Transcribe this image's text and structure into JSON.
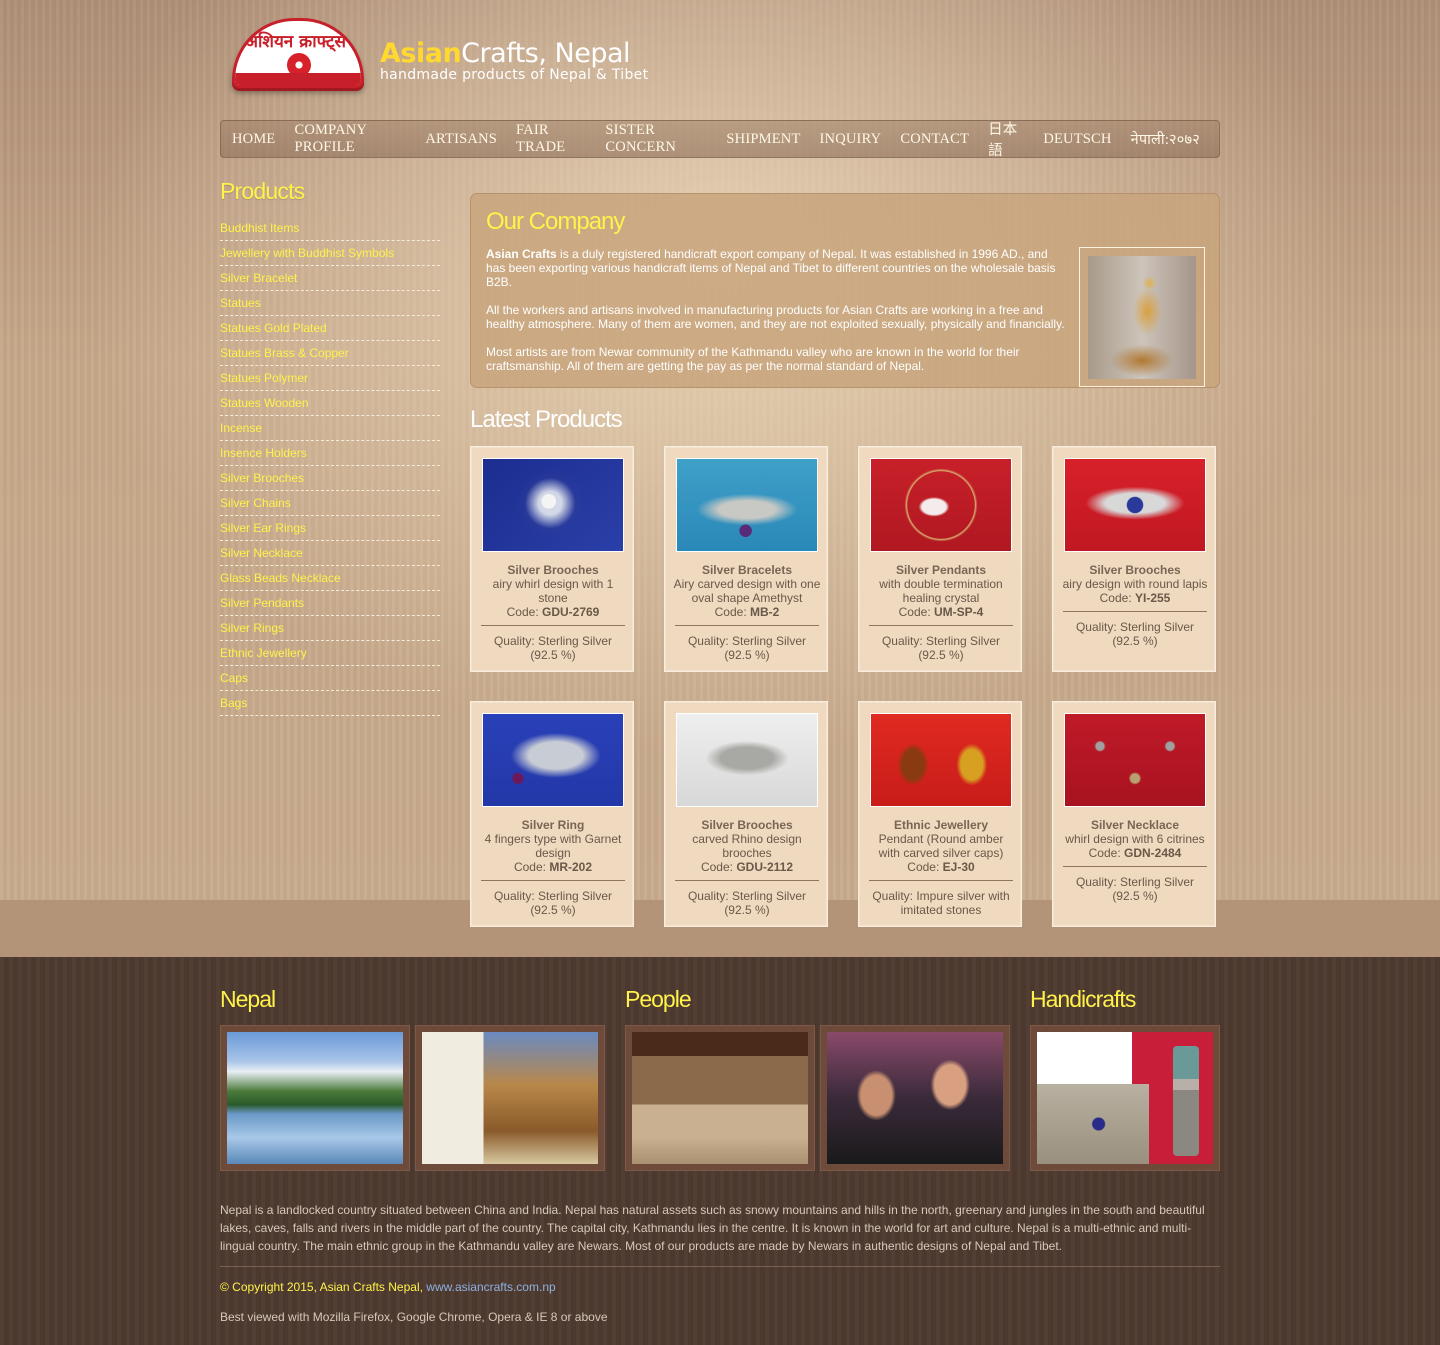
{
  "header": {
    "logo_script": "अशियन क्राफ्ट्स",
    "brand_bold": "Asian",
    "brand_rest": "Crafts, Nepal",
    "tagline": "handmade products of Nepal & Tibet"
  },
  "nav": [
    "HOME",
    "COMPANY PROFILE",
    "ARTISANS",
    "FAIR TRADE",
    "SISTER CONCERN",
    "SHIPMENT",
    "INQUIRY",
    "CONTACT",
    "日本語",
    "DEUTSCH",
    "नेपाली:२०७२"
  ],
  "sidebar": {
    "title": "Products",
    "items": [
      "Buddhist Items",
      "Jewellery with Buddhist Symbols",
      "Silver Bracelet",
      "Statues",
      "Statues Gold Plated",
      "Statues Brass & Copper",
      "Statues Polymer",
      "Statues Wooden",
      "Incense",
      "Insence Holders",
      "Silver Brooches",
      "Silver Chains",
      "Silver Ear Rings",
      "Silver Necklace",
      "Glass Beads Necklace",
      "Silver Pendants",
      "Silver Rings",
      "Ethnic Jewellery",
      "Caps",
      "Bags"
    ]
  },
  "company": {
    "title": "Our Company",
    "p1_bold": "Asian Crafts",
    "p1_rest": " is a duly registered handicraft export company of Nepal. It was established in 1996 AD., and has been exporting various handicraft items of Nepal and Tibet to different countries on the wholesale basis B2B.",
    "p2": "All the workers and artisans involved in manufacturing products for Asian Crafts are working in a free and healthy atmosphere. Many of them are women, and they are not exploited sexually, physically and financially.",
    "p3": "Most artists are from Newar community of the Kathmandu valley who are known in the world for their craftsmanship. All of them are getting the pay as per the normal standard of Nepal."
  },
  "latest": {
    "title": "Latest Products",
    "code_label": "Code: ",
    "products": [
      {
        "title": "Silver Brooches",
        "desc": "airy whirl design with 1 stone",
        "code": "GDU-2769",
        "quality": "Quality: Sterling Silver (92.5 %)"
      },
      {
        "title": "Silver Bracelets",
        "desc": "Airy carved design with one oval shape Amethyst",
        "code": "MB-2",
        "quality": "Quality: Sterling Silver (92.5 %)"
      },
      {
        "title": "Silver Pendants",
        "desc": "with double termination healing crystal",
        "code": "UM-SP-4",
        "quality": "Quality: Sterling Silver (92.5 %)"
      },
      {
        "title": "Silver Brooches",
        "desc": "airy design with round lapis",
        "code": "YI-255",
        "quality": "Quality: Sterling Silver (92.5 %)"
      },
      {
        "title": "Silver Ring",
        "desc": "4 fingers type with Garnet design",
        "code": "MR-202",
        "quality": "Quality: Sterling Silver (92.5 %)"
      },
      {
        "title": "Silver Brooches",
        "desc": "carved Rhino design brooches",
        "code": "GDU-2112",
        "quality": "Quality: Sterling Silver (92.5 %)"
      },
      {
        "title": "Ethnic Jewellery",
        "desc": "Pendant (Round amber with carved silver caps)",
        "code": "EJ-30",
        "quality": "Quality: Impure silver with imitated stones"
      },
      {
        "title": "Silver Necklace",
        "desc": "whirl design with 6 citrines",
        "code": "GDN-2484",
        "quality": "Quality: Sterling Silver (92.5 %)"
      }
    ]
  },
  "footer": {
    "nepal_title": "Nepal",
    "people_title": "People",
    "handicrafts_title": "Handicrafts",
    "about": "Nepal is a landlocked country situated between China and India. Nepal has natural assets such as snowy mountains and hills in the north, greenary and jungles in the south and beautiful lakes, caves, falls and rivers in the middle part of the country. The capital city, Kathmandu lies in the centre. It is known in the world for art and culture. Nepal is a multi-ethnic and multi-lingual country. The main ethnic group in the Kathmandu valley are Newars. Most of our products are made by Newars in authentic designs of Nepal and Tibet.",
    "copyright": "© Copyright 2015, Asian Crafts Nepal, ",
    "link": "www.asiancrafts.com.np",
    "best_viewed": "Best viewed with Mozilla Firefox, Google Chrome, Opera & IE 8 or above"
  },
  "colors": {
    "accent_yellow": "#fff24a",
    "card_bg": "#efd9bf",
    "footer_bg": "#4e3b30"
  }
}
